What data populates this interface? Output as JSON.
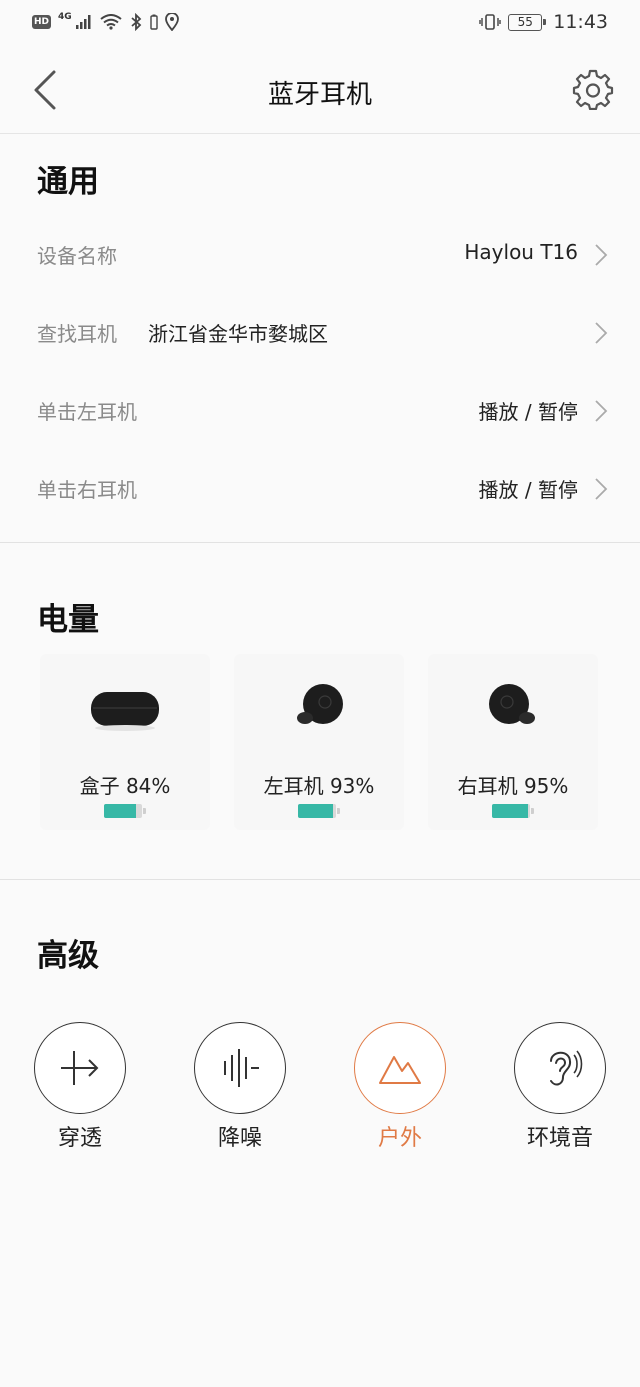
{
  "status_bar": {
    "hd": "HD",
    "network": "4G",
    "battery": "55",
    "time": "11:43",
    "icons": [
      "signal-icon",
      "wifi-icon",
      "bluetooth-icon",
      "location-icon",
      "vibrate-icon"
    ]
  },
  "header": {
    "title": "蓝牙耳机",
    "back_icon": "chevron-left-icon",
    "settings_icon": "gear-icon"
  },
  "general": {
    "title": "通用",
    "rows": [
      {
        "label": "设备名称",
        "value": "Haylou T16"
      },
      {
        "label": "查找耳机",
        "inline_value": "浙江省金华市婺城区"
      },
      {
        "label": "单击左耳机",
        "value": "播放 / 暂停"
      },
      {
        "label": "单击右耳机",
        "value": "播放 / 暂停"
      }
    ]
  },
  "battery": {
    "title": "电量",
    "items": [
      {
        "label": "盒子 84%",
        "level": 0.84
      },
      {
        "label": "左耳机 93%",
        "level": 0.93
      },
      {
        "label": "右耳机 95%",
        "level": 0.95
      }
    ],
    "bar_color": "#37b8a6"
  },
  "advanced": {
    "title": "高级",
    "modes": [
      {
        "label": "穿透",
        "icon": "passthrough-icon",
        "active": false
      },
      {
        "label": "降噪",
        "icon": "noise-cancel-icon",
        "active": false
      },
      {
        "label": "户外",
        "icon": "mountain-icon",
        "active": true
      },
      {
        "label": "环境音",
        "icon": "ear-icon",
        "active": false
      }
    ],
    "active_color": "#e07a45"
  }
}
